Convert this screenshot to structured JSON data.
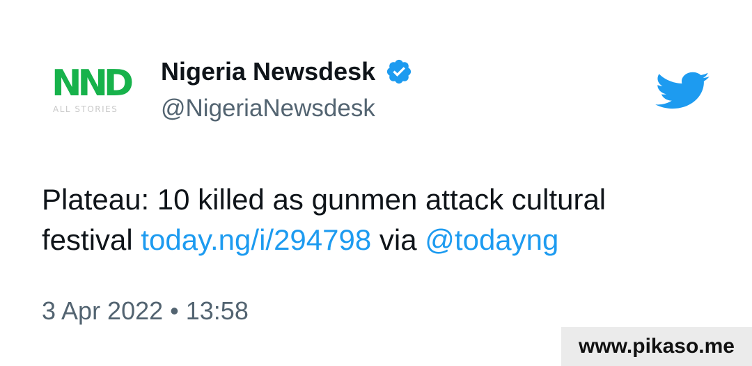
{
  "tweet": {
    "avatar": {
      "logo_text": "NND",
      "logo_subtitle": "ALL STORIES",
      "logo_color": "#17b24b"
    },
    "author": {
      "display_name": "Nigeria Newsdesk",
      "handle": "@NigeriaNewsdesk",
      "verified": true,
      "verified_icon": "verified-badge-icon"
    },
    "platform_icon": "twitter-bird-icon",
    "text": {
      "line1": "Plateau: 10 killed as gunmen attack cultural",
      "word_festival": "festival",
      "link": "today.ng/i/294798",
      "via": "via",
      "mention": "@todayng"
    },
    "timestamp": "3 Apr 2022 • 13:58"
  },
  "watermark": {
    "text": "www.pikaso.me"
  },
  "colors": {
    "link": "#1d9bf0",
    "text": "#0f1419",
    "secondary": "#536471",
    "twitter_blue": "#1d9bf0"
  }
}
